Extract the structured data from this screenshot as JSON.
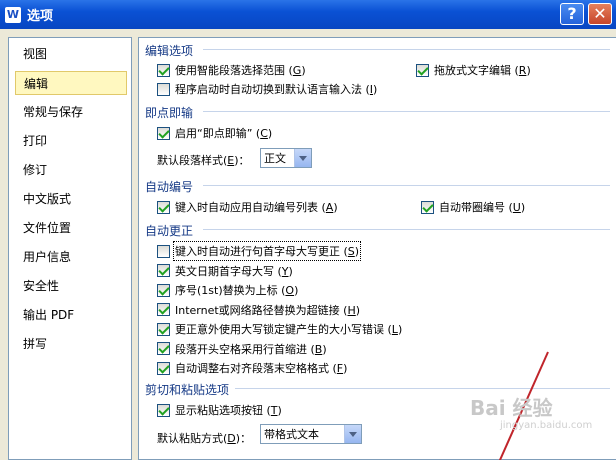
{
  "window": {
    "title": "选项",
    "logo_letter": "W",
    "help_label": "?",
    "close_label": "✕"
  },
  "nav": [
    {
      "label": "视图"
    },
    {
      "label": "编辑",
      "selected": true
    },
    {
      "label": "常规与保存"
    },
    {
      "label": "打印"
    },
    {
      "label": "修订"
    },
    {
      "label": "中文版式"
    },
    {
      "label": "文件位置"
    },
    {
      "label": "用户信息"
    },
    {
      "label": "安全性"
    },
    {
      "label": "输出 PDF"
    },
    {
      "label": "拼写"
    }
  ],
  "sections": {
    "editing": {
      "title": "编辑选项",
      "smart_select": {
        "label": "使用智能段落选择范围",
        "key": "G",
        "checked": true
      },
      "drag_drop": {
        "label": "拖放式文字编辑",
        "key": "R",
        "checked": true
      },
      "auto_ime": {
        "label": "程序启动时自动切换到默认语言输入法",
        "key": "I",
        "checked": false
      }
    },
    "instant_input": {
      "title": "即点即输",
      "enable": {
        "label": "启用“即点即输”",
        "key": "C",
        "checked": true
      },
      "style_label": "默认段落样式",
      "style_key": "E",
      "style_value": "正文"
    },
    "auto_numbering": {
      "title": "自动编号",
      "apply_list": {
        "label": "键入时自动应用自动编号列表",
        "key": "A",
        "checked": true
      },
      "circle_num": {
        "label": "自动带圈编号",
        "key": "U",
        "checked": true
      }
    },
    "autocorrect": {
      "title": "自动更正",
      "items": [
        {
          "label": "键入时自动进行句首字母大写更正",
          "key": "S",
          "checked": false,
          "focused": true
        },
        {
          "label": "英文日期首字母大写",
          "key": "Y",
          "checked": true
        },
        {
          "label": "序号(1st)替换为上标",
          "key": "O",
          "checked": true
        },
        {
          "label": "Internet或网络路径替换为超链接",
          "key": "H",
          "checked": true
        },
        {
          "label": "更正意外使用大写锁定键产生的大小写错误",
          "key": "L",
          "checked": true
        },
        {
          "label": "段落开头空格采用行首缩进",
          "key": "B",
          "checked": true
        },
        {
          "label": "自动调整右对齐段落末空格格式",
          "key": "F",
          "checked": true
        }
      ]
    },
    "paste": {
      "title": "剪切和粘贴选项",
      "show_btn": {
        "label": "显示粘贴选项按钮",
        "key": "T",
        "checked": true
      },
      "mode_label": "默认粘贴方式",
      "mode_key": "D",
      "mode_value": "带格式文本"
    }
  },
  "watermark": {
    "text": "Bai 经验",
    "sub": "jingyan.baidu.com"
  }
}
